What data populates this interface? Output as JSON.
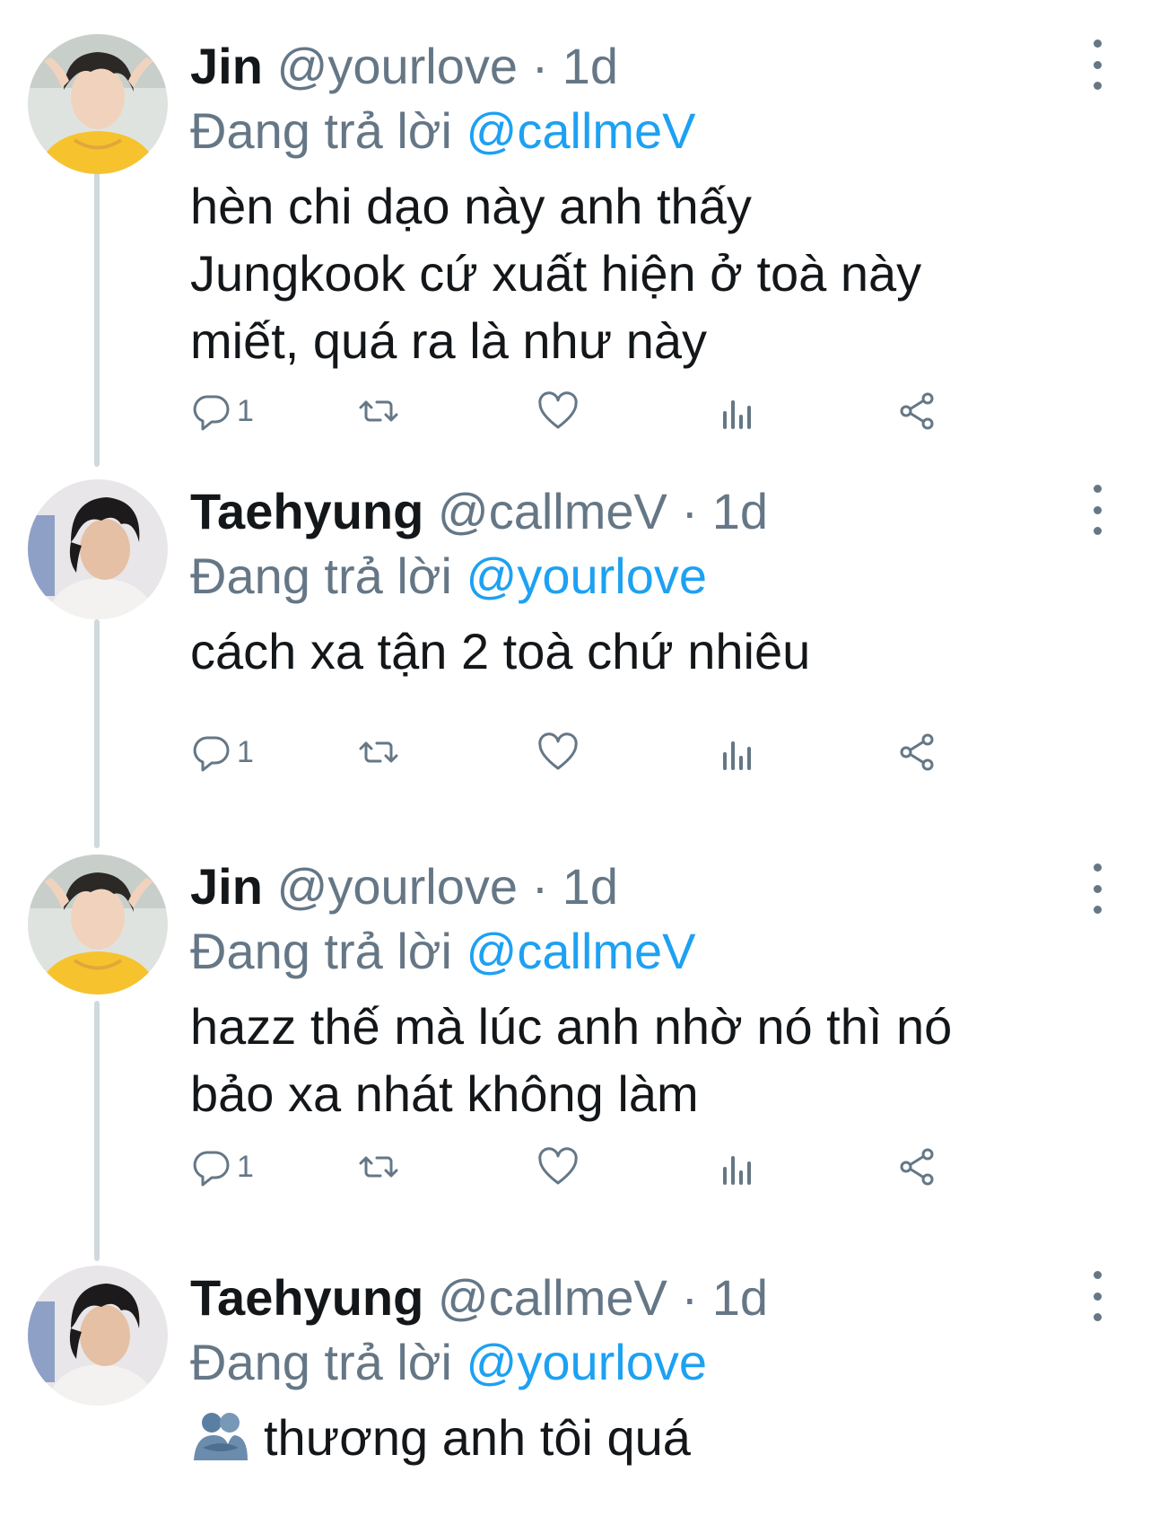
{
  "tweets": [
    {
      "name": "Jin",
      "handle": "@yourlove",
      "separator": "·",
      "time": "1d",
      "reply_prefix": "Đang trả lời",
      "reply_to": "@callmeV",
      "lines": [
        "hèn chi dạo này anh thấy",
        "Jungkook cứ xuất hiện ở toà này",
        "miết, quá ra là như này"
      ],
      "reply_count": "1"
    },
    {
      "name": "Taehyung",
      "handle": "@callmeV",
      "separator": "·",
      "time": "1d",
      "reply_prefix": "Đang trả lời",
      "reply_to": "@yourlove",
      "lines": [
        "cách xa tận 2 toà chứ nhiêu"
      ],
      "reply_count": "1"
    },
    {
      "name": "Jin",
      "handle": "@yourlove",
      "separator": "·",
      "time": "1d",
      "reply_prefix": "Đang trả lời",
      "reply_to": "@callmeV",
      "lines": [
        "hazz thế mà lúc anh nhờ nó thì nó",
        "bảo xa nhát không làm"
      ],
      "reply_count": "1"
    },
    {
      "name": "Taehyung",
      "handle": "@callmeV",
      "separator": "·",
      "time": "1d",
      "reply_prefix": "Đang trả lời",
      "reply_to": "@yourlove",
      "lines": [
        "thương anh tôi quá"
      ],
      "emoji": "people-hugging-emoji"
    }
  ],
  "icons": {
    "reply": "comment-icon",
    "retweet": "retweet-icon",
    "like": "heart-icon",
    "views": "analytics-icon",
    "share": "share-icon",
    "more": "more-vertical-icon"
  },
  "colors": {
    "accent": "#1da1f2",
    "secondary_text": "#657786",
    "thread_line": "#cfd9de"
  }
}
